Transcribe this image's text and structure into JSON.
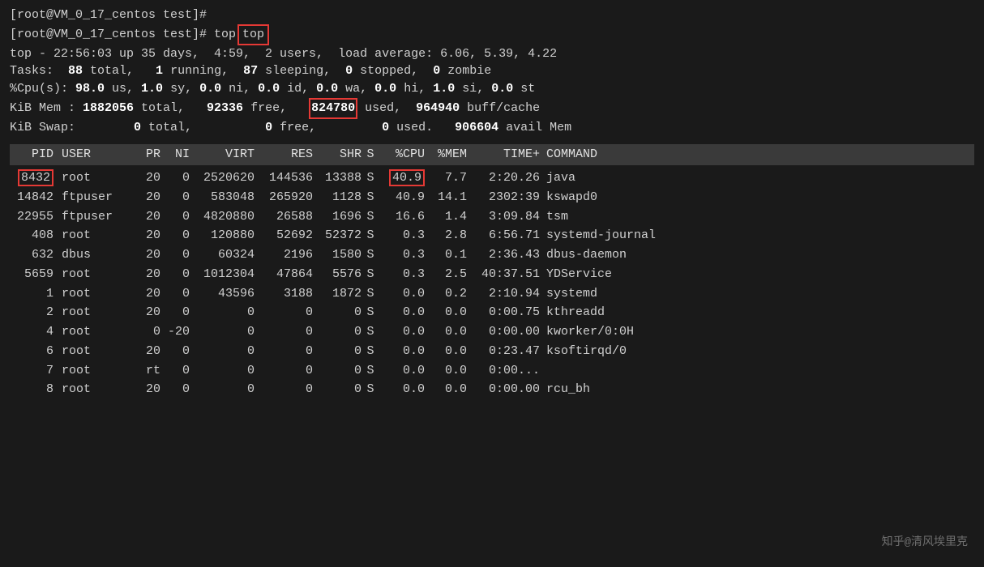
{
  "terminal": {
    "prompt1": "[root@VM_0_17_centos test]#",
    "prompt2": "[root@VM_0_17_centos test]# top",
    "top_cmd": "top",
    "line_time": "top - 22:56:03 up 35 days,  4:59,  2 users,  load average: 6.06, 5.39, 4.22",
    "line_tasks_pre": "Tasks:  ",
    "tasks_total_val": "88",
    "tasks_total_lbl": " total,   ",
    "tasks_run_val": "1",
    "tasks_run_lbl": " running,  ",
    "tasks_sleep_val": "87",
    "tasks_sleep_lbl": " sleeping,  ",
    "tasks_stop_val": "0",
    "tasks_stop_lbl": " stopped,  ",
    "tasks_zombie_val": "0",
    "tasks_zombie_lbl": " zombie",
    "line_cpu_pre": "%Cpu(s): ",
    "cpu_us_val": "98.0",
    "cpu_us_lbl": " us, ",
    "cpu_sy_val": "1.0",
    "cpu_sy_lbl": " sy, ",
    "cpu_ni_val": "0.0",
    "cpu_ni_lbl": " ni, ",
    "cpu_id_val": "0.0",
    "cpu_id_lbl": " id, ",
    "cpu_wa_val": "0.0",
    "cpu_wa_lbl": " wa, ",
    "cpu_hi_val": "0.0",
    "cpu_hi_lbl": " hi, ",
    "cpu_si_val": "1.0",
    "cpu_si_lbl": " si, ",
    "cpu_st_val": "0.0",
    "cpu_st_lbl": " st",
    "line_mem": "KiB Mem : ",
    "mem_total_val": "1882056",
    "mem_total_lbl": " total,   ",
    "mem_free_val": "92336",
    "mem_free_lbl": " free,   ",
    "mem_used_val": "824780",
    "mem_used_lbl": " used,  ",
    "mem_cache_val": "964940",
    "mem_cache_lbl": " buff/cache",
    "line_swap": "KiB Swap:        ",
    "swap_total_val": "0",
    "swap_total_lbl": " total,          ",
    "swap_free_val": "0",
    "swap_free_lbl": " free,         ",
    "swap_used_val": "0",
    "swap_used_lbl": " used.   ",
    "swap_avail_val": "906604",
    "swap_avail_lbl": " avail Mem",
    "table_headers": {
      "pid": "PID",
      "user": "USER",
      "pr": "PR",
      "ni": "NI",
      "virt": "VIRT",
      "res": "RES",
      "shr": "SHR",
      "s": "S",
      "cpu": "%CPU",
      "mem": "%MEM",
      "time": "TIME+",
      "cmd": "COMMAND"
    },
    "processes": [
      {
        "pid": "8432",
        "user": "root",
        "pr": "20",
        "ni": "0",
        "virt": "2520620",
        "res": "144536",
        "shr": "13388",
        "s": "S",
        "cpu": "40.9",
        "mem": "7.7",
        "time": "2:20.26",
        "cmd": "java",
        "highlight_pid": true,
        "highlight_cpu": true
      },
      {
        "pid": "14842",
        "user": "ftpuser",
        "pr": "20",
        "ni": "0",
        "virt": "583048",
        "res": "265920",
        "shr": "1128",
        "s": "S",
        "cpu": "40.9",
        "mem": "14.1",
        "time": "2302:39",
        "cmd": "kswapd0",
        "highlight_pid": false,
        "highlight_cpu": false
      },
      {
        "pid": "22955",
        "user": "ftpuser",
        "pr": "20",
        "ni": "0",
        "virt": "4820880",
        "res": "26588",
        "shr": "1696",
        "s": "S",
        "cpu": "16.6",
        "mem": "1.4",
        "time": "3:09.84",
        "cmd": "tsm",
        "highlight_pid": false,
        "highlight_cpu": false
      },
      {
        "pid": "408",
        "user": "root",
        "pr": "20",
        "ni": "0",
        "virt": "120880",
        "res": "52692",
        "shr": "52372",
        "s": "S",
        "cpu": "0.3",
        "mem": "2.8",
        "time": "6:56.71",
        "cmd": "systemd-journal",
        "highlight_pid": false,
        "highlight_cpu": false
      },
      {
        "pid": "632",
        "user": "dbus",
        "pr": "20",
        "ni": "0",
        "virt": "60324",
        "res": "2196",
        "shr": "1580",
        "s": "S",
        "cpu": "0.3",
        "mem": "0.1",
        "time": "2:36.43",
        "cmd": "dbus-daemon",
        "highlight_pid": false,
        "highlight_cpu": false
      },
      {
        "pid": "5659",
        "user": "root",
        "pr": "20",
        "ni": "0",
        "virt": "1012304",
        "res": "47864",
        "shr": "5576",
        "s": "S",
        "cpu": "0.3",
        "mem": "2.5",
        "time": "40:37.51",
        "cmd": "YDService",
        "highlight_pid": false,
        "highlight_cpu": false
      },
      {
        "pid": "1",
        "user": "root",
        "pr": "20",
        "ni": "0",
        "virt": "43596",
        "res": "3188",
        "shr": "1872",
        "s": "S",
        "cpu": "0.0",
        "mem": "0.2",
        "time": "2:10.94",
        "cmd": "systemd",
        "highlight_pid": false,
        "highlight_cpu": false
      },
      {
        "pid": "2",
        "user": "root",
        "pr": "20",
        "ni": "0",
        "virt": "0",
        "res": "0",
        "shr": "0",
        "s": "S",
        "cpu": "0.0",
        "mem": "0.0",
        "time": "0:00.75",
        "cmd": "kthreadd",
        "highlight_pid": false,
        "highlight_cpu": false
      },
      {
        "pid": "4",
        "user": "root",
        "pr": "0",
        "ni": "-20",
        "virt": "0",
        "res": "0",
        "shr": "0",
        "s": "S",
        "cpu": "0.0",
        "mem": "0.0",
        "time": "0:00.00",
        "cmd": "kworker/0:0H",
        "highlight_pid": false,
        "highlight_cpu": false
      },
      {
        "pid": "6",
        "user": "root",
        "pr": "20",
        "ni": "0",
        "virt": "0",
        "res": "0",
        "shr": "0",
        "s": "S",
        "cpu": "0.0",
        "mem": "0.0",
        "time": "0:23.47",
        "cmd": "ksoftirqd/0",
        "highlight_pid": false,
        "highlight_cpu": false
      },
      {
        "pid": "7",
        "user": "root",
        "pr": "rt",
        "ni": "0",
        "virt": "0",
        "res": "0",
        "shr": "0",
        "s": "S",
        "cpu": "0.0",
        "mem": "0.0",
        "time": "0:00...",
        "cmd": "",
        "highlight_pid": false,
        "highlight_cpu": false
      },
      {
        "pid": "8",
        "user": "root",
        "pr": "20",
        "ni": "0",
        "virt": "0",
        "res": "0",
        "shr": "0",
        "s": "S",
        "cpu": "0.0",
        "mem": "0.0",
        "time": "0:00.00",
        "cmd": "rcu_bh",
        "highlight_pid": false,
        "highlight_cpu": false
      }
    ],
    "watermark": "知乎@清风埃里克"
  }
}
